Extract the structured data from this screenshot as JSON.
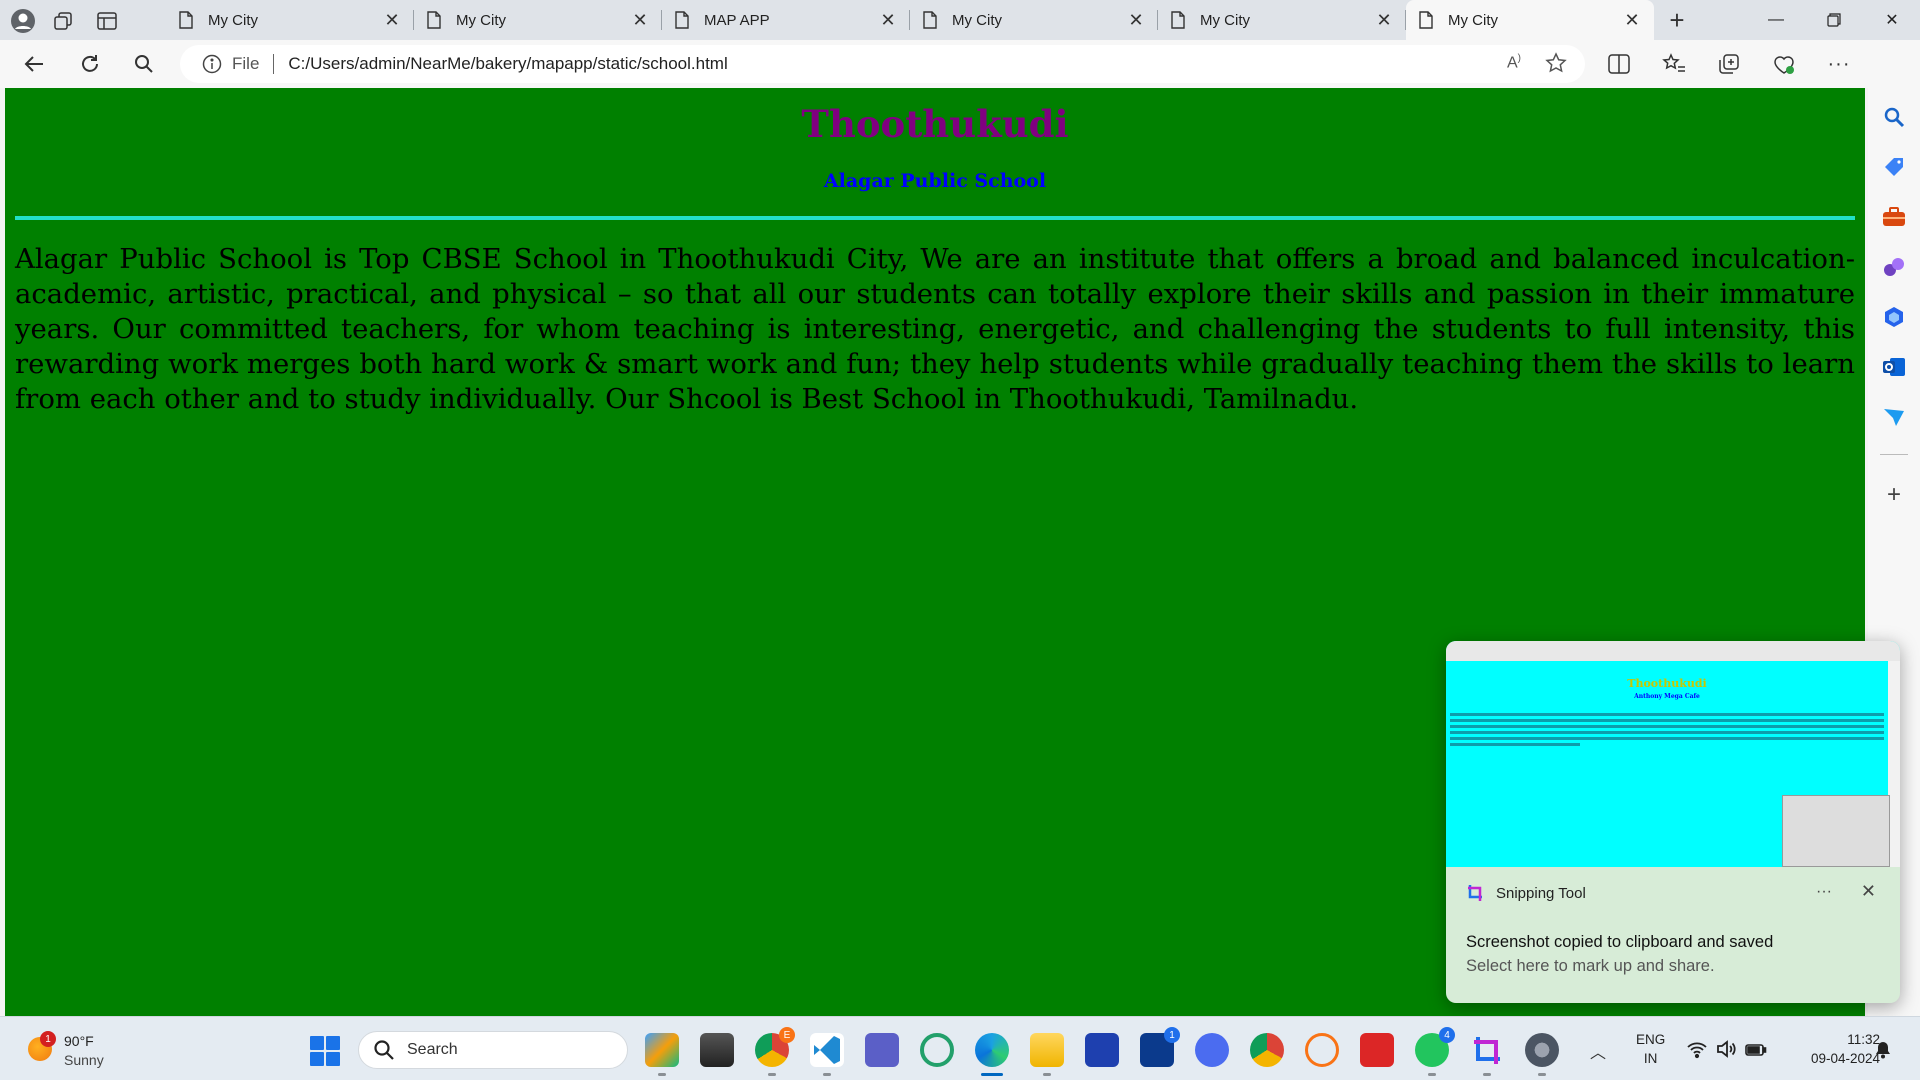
{
  "browser": {
    "tabs": [
      {
        "label": "My City"
      },
      {
        "label": "My City"
      },
      {
        "label": "MAP APP"
      },
      {
        "label": "My City"
      },
      {
        "label": "My City"
      },
      {
        "label": "My City",
        "active": true
      }
    ],
    "address": {
      "scheme_label": "File",
      "url": "C:/Users/admin/NearMe/bakery/mapapp/static/school.html"
    }
  },
  "page": {
    "heading": "Thoothukudi",
    "subheading": "Alagar Public School",
    "paragraph": "Alagar Public School is Top CBSE School in Thoothukudi City, We are an institute that offers a broad and balanced inculcation- academic, artistic, practical, and physical – so that all our students can totally explore their skills and passion in their immature years. Our committed teachers, for whom teaching is interesting, energetic, and challenging the students to full intensity, this rewarding work merges both hard work & smart work and fun; they help students while gradually teaching them the skills to learn from each other and to study individually. Our Shcool is Best School in Thoothukudi, Tamilnadu.",
    "colors": {
      "background": "#008000",
      "heading": "#800080",
      "subheading": "#0000ff",
      "rule": "#22e0c8"
    }
  },
  "toast": {
    "app_name": "Snipping Tool",
    "title": "Screenshot copied to clipboard and saved",
    "body": "Select here to mark up and share.",
    "preview_heading": "Thoothukudi",
    "preview_subheading": "Anthony Mega Cafe"
  },
  "taskbar": {
    "weather": {
      "temp": "90°F",
      "condition": "Sunny",
      "badge": "1"
    },
    "search_placeholder": "Search",
    "language": {
      "line1": "ENG",
      "line2": "IN"
    },
    "clock": {
      "time": "11:32",
      "date": "09-04-2024"
    },
    "apps": [
      {
        "name": "copilot-pre-app"
      },
      {
        "name": "file-explorer-app"
      },
      {
        "name": "chrome-e-app",
        "badge": "E"
      },
      {
        "name": "vscode-app"
      },
      {
        "name": "teams-app"
      },
      {
        "name": "circle-app"
      },
      {
        "name": "edge-app",
        "active": true
      },
      {
        "name": "folder-app"
      },
      {
        "name": "store-app"
      },
      {
        "name": "l-app",
        "badge": "1"
      },
      {
        "name": "triangle-app"
      },
      {
        "name": "chrome-app"
      },
      {
        "name": "orange-app"
      },
      {
        "name": "wps-app"
      },
      {
        "name": "whatsapp-app",
        "badge": "4"
      },
      {
        "name": "snipping-tool-app"
      },
      {
        "name": "settings-app"
      }
    ]
  }
}
